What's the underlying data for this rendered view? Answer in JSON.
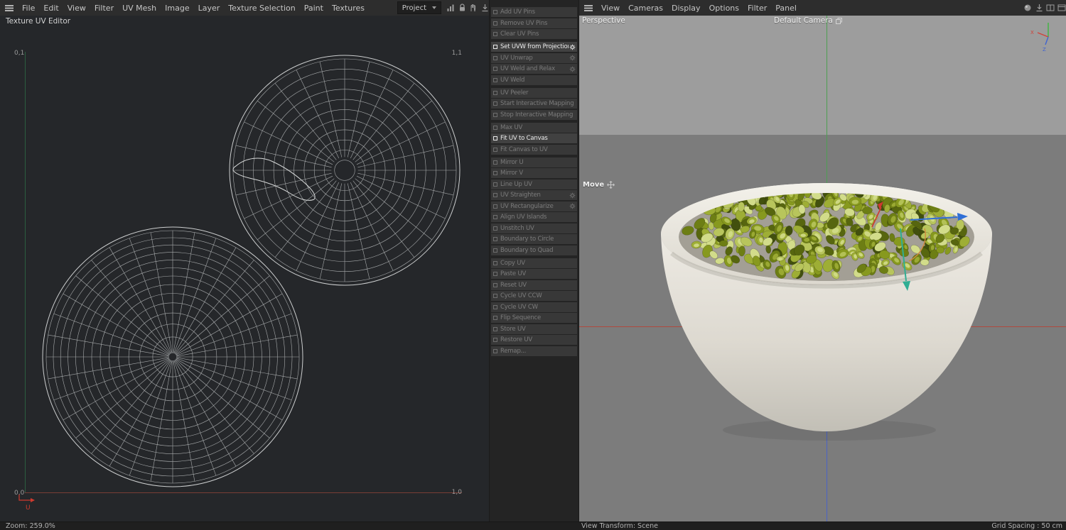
{
  "colors": {
    "accent_red": "#cf3a30",
    "accent_green": "#3db53d",
    "accent_blue": "#3f63d0",
    "pea_palette": [
      "#42500e",
      "#57660f",
      "#6d7e14",
      "#87991e",
      "#9eae35",
      "#b8c55c",
      "#d2dc8a"
    ]
  },
  "menubar_left": {
    "items": [
      "File",
      "Edit",
      "View",
      "Filter",
      "UV Mesh",
      "Image",
      "Layer",
      "Texture Selection",
      "Paint",
      "Textures"
    ],
    "project_select": "Project",
    "icons": [
      "chart-icon",
      "lock-icon",
      "hand-icon",
      "download-icon"
    ]
  },
  "uv_editor": {
    "title": "Texture UV Editor",
    "corners": {
      "top_left": "0,1",
      "top_right": "1,1",
      "bottom_left": "0,0",
      "bottom_right": "1,0"
    },
    "axis_u": "U",
    "zoom_status": "Zoom: 259.0%"
  },
  "uv_commands": {
    "groups": [
      {
        "items": [
          {
            "label": "Add UV Pins",
            "enabled": false
          },
          {
            "label": "Remove UV Pins",
            "enabled": false
          },
          {
            "label": "Clear UV Pins",
            "enabled": false
          }
        ]
      },
      {
        "items": [
          {
            "label": "Set UVW from Projection",
            "enabled": true,
            "gear": true
          },
          {
            "label": "UV Unwrap",
            "enabled": false,
            "gear": true
          },
          {
            "label": "UV Weld and Relax",
            "enabled": false,
            "gear": true
          },
          {
            "label": "UV Weld",
            "enabled": false
          }
        ]
      },
      {
        "items": [
          {
            "label": "UV Peeler",
            "enabled": false
          },
          {
            "label": "Start Interactive Mapping",
            "enabled": false
          },
          {
            "label": "Stop Interactive Mapping",
            "enabled": false
          }
        ]
      },
      {
        "items": [
          {
            "label": "Max UV",
            "enabled": false
          },
          {
            "label": "Fit UV to Canvas",
            "enabled": true
          },
          {
            "label": "Fit Canvas to UV",
            "enabled": false
          }
        ]
      },
      {
        "items": [
          {
            "label": "Mirror U",
            "enabled": false
          },
          {
            "label": "Mirror V",
            "enabled": false
          },
          {
            "label": "Line Up UV",
            "enabled": false
          },
          {
            "label": "UV Straighten",
            "enabled": false,
            "gear": true
          },
          {
            "label": "UV Rectangularize",
            "enabled": false,
            "gear": true
          },
          {
            "label": "Align UV Islands",
            "enabled": false
          },
          {
            "label": "Unstitch UV",
            "enabled": false
          },
          {
            "label": "Boundary to Circle",
            "enabled": false
          },
          {
            "label": "Boundary to Quad",
            "enabled": false
          }
        ]
      },
      {
        "items": [
          {
            "label": "Copy UV",
            "enabled": false
          },
          {
            "label": "Paste UV",
            "enabled": false
          },
          {
            "label": "Reset UV",
            "enabled": false
          },
          {
            "label": "Cycle UV CCW",
            "enabled": false
          },
          {
            "label": "Cycle UV CW",
            "enabled": false
          },
          {
            "label": "Flip Sequence",
            "enabled": false
          },
          {
            "label": "Store UV",
            "enabled": false
          },
          {
            "label": "Restore UV",
            "enabled": false
          },
          {
            "label": "Remap...",
            "enabled": false
          }
        ]
      }
    ]
  },
  "viewport": {
    "menu": [
      "View",
      "Cameras",
      "Display",
      "Options",
      "Filter",
      "Panel"
    ],
    "icons": [
      "render-sphere-icon",
      "download-icon",
      "panel-split-icon",
      "panel-icon"
    ],
    "perspective": "Perspective",
    "camera": "Default Camera",
    "tool": "Move",
    "gizmo": {
      "x": "X",
      "z": "Z"
    },
    "status_left": "View Transform: Scene",
    "status_right": "Grid Spacing : 50 cm"
  }
}
